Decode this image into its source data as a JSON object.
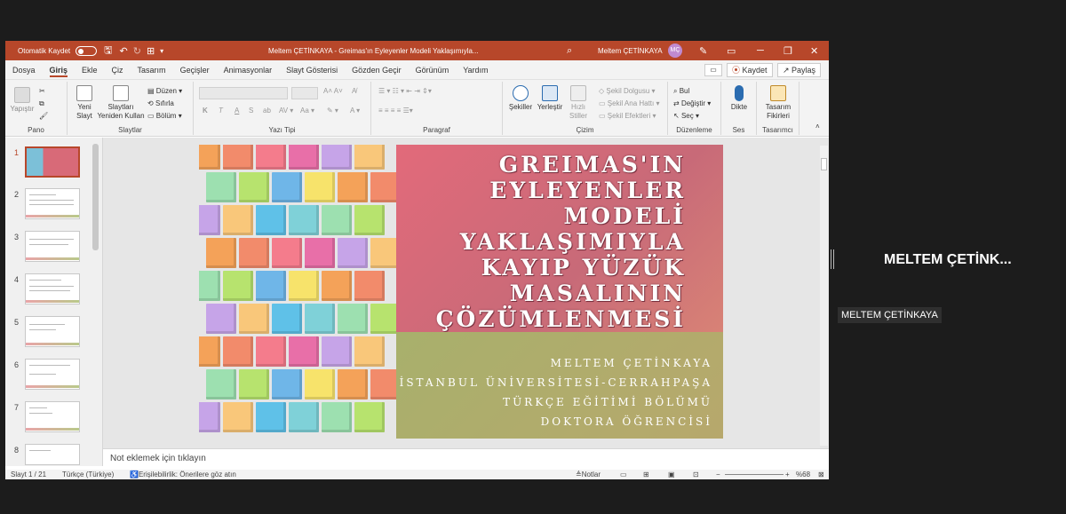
{
  "window": {
    "autosave_label": "Otomatik Kaydet",
    "doc_title": "Meltem ÇETİNKAYA - Greimas'ın Eyleyenler Modeli Yaklaşımıyla...",
    "user_name": "Meltem ÇETİNKAYA",
    "user_initials": "MÇ"
  },
  "tabs": [
    "Dosya",
    "Giriş",
    "Ekle",
    "Çiz",
    "Tasarım",
    "Geçişler",
    "Animasyonlar",
    "Slayt Gösterisi",
    "Gözden Geçir",
    "Görünüm",
    "Yardım"
  ],
  "tab_actions": {
    "save": "Kaydet",
    "share": "Paylaş"
  },
  "ribbon": {
    "pano": {
      "label": "Pano",
      "paste": "Yapıştır"
    },
    "slaytlar": {
      "label": "Slaytlar",
      "new_slide": "Yeni Slayt",
      "reuse": "Slaytları Yeniden Kullan",
      "layout": "Düzen",
      "reset": "Sıfırla",
      "section": "Bölüm"
    },
    "yazi": {
      "label": "Yazı Tipi",
      "bold": "K",
      "italic": "T",
      "underline": "A",
      "strike": "S",
      "shadow": "ab"
    },
    "paragraf": {
      "label": "Paragraf"
    },
    "cizim": {
      "label": "Çizim",
      "shapes": "Şekiller",
      "arrange": "Yerleştir",
      "quick_styles": "Hızlı Stiller",
      "fill": "Şekil Dolgusu",
      "outline": "Şekil Ana Hattı",
      "effects": "Şekil Efektleri"
    },
    "duzenleme": {
      "label": "Düzenleme",
      "find": "Bul",
      "replace": "Değiştir",
      "select": "Seç"
    },
    "ses": {
      "label": "Ses",
      "dictate": "Dikte"
    },
    "tasarimci": {
      "label": "Tasarımcı",
      "design_ideas": "Tasarım Fikirleri"
    }
  },
  "thumbnails": [
    "1",
    "2",
    "3",
    "4",
    "5",
    "6",
    "7",
    "8"
  ],
  "slide": {
    "title_lines": [
      "GREIMAS'IN",
      "EYLEYENLER",
      "MODELİ",
      "YAKLAŞIMIYLA",
      "KAYIP YÜZÜK",
      "MASALININ",
      "ÇÖZÜMLENMESİ"
    ],
    "subtitle_lines": [
      "MELTEM ÇETİNKAYA",
      "İSTANBUL ÜNİVERSİTESİ-CERRAHPAŞA",
      "TÜRKÇE EĞİTİMİ BÖLÜMÜ",
      "DOKTORA ÖĞRENCİSİ"
    ]
  },
  "notes_placeholder": "Not eklemek için tıklayın",
  "status": {
    "slide_count": "Slayt 1 / 21",
    "language": "Türkçe (Türkiye)",
    "accessibility": "Erişilebilirlik: Önerilere göz atın",
    "notes_btn": "Notlar",
    "zoom": "%68"
  },
  "meeting": {
    "participant_display": "MELTEM ÇETİNK...",
    "participant_tag": "MELTEM ÇETİNKAYA"
  }
}
